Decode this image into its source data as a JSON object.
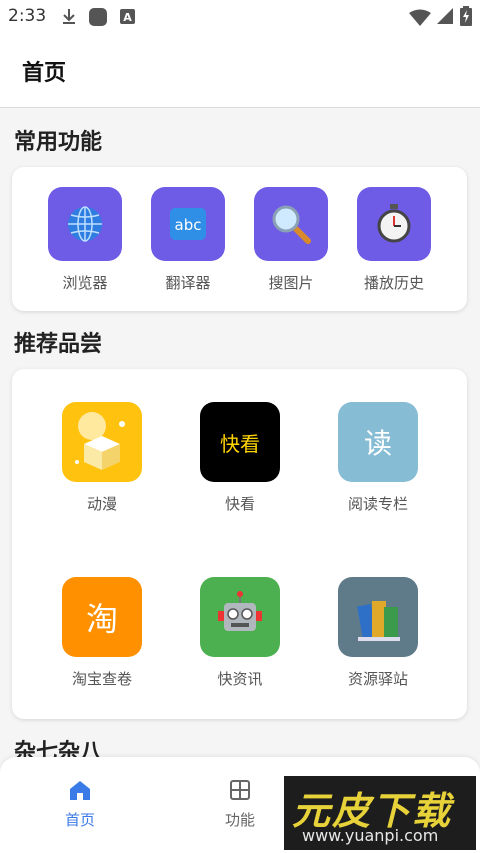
{
  "status_bar": {
    "time": "2:33",
    "icons": [
      "download-icon",
      "app-square-icon",
      "keyboard-a-icon",
      "wifi-icon",
      "signal-icon",
      "battery-charging-icon"
    ]
  },
  "header": {
    "title": "首页"
  },
  "common": {
    "title": "常用功能",
    "items": [
      {
        "label": "浏览器",
        "icon": "globe-icon"
      },
      {
        "label": "翻译器",
        "icon": "abc-icon",
        "icon_text": "abc"
      },
      {
        "label": "搜图片",
        "icon": "magnifier-icon"
      },
      {
        "label": "播放历史",
        "icon": "stopwatch-icon"
      }
    ],
    "icon_bg": "#6e5ce6"
  },
  "recommend": {
    "title": "推荐品尝",
    "items": [
      {
        "label": "动漫",
        "icon": "box-illustration-icon",
        "color": "#ffc20e"
      },
      {
        "label": "快看",
        "icon": "kuaikan-logo-icon",
        "glyph": "快看",
        "color": "#000000"
      },
      {
        "label": "阅读专栏",
        "icon": "read-icon",
        "glyph": "读",
        "color": "#86bcd4"
      },
      {
        "label": "淘宝查卷",
        "icon": "taobao-icon",
        "glyph": "淘",
        "color": "#ff9000"
      },
      {
        "label": "快资讯",
        "icon": "robot-icon",
        "color": "#4caf50"
      },
      {
        "label": "资源驿站",
        "icon": "books-icon",
        "color": "#5f7b8a"
      }
    ]
  },
  "misc": {
    "title": "杂七杂八"
  },
  "bottom_nav": {
    "items": [
      {
        "label": "首页",
        "icon": "home-icon",
        "active": true
      },
      {
        "label": "功能",
        "icon": "grid-icon",
        "active": false
      }
    ],
    "active_color": "#3b7be8",
    "inactive_color": "#666666"
  },
  "watermark": {
    "title": "元皮下载",
    "url": "www.yuanpi.com"
  }
}
